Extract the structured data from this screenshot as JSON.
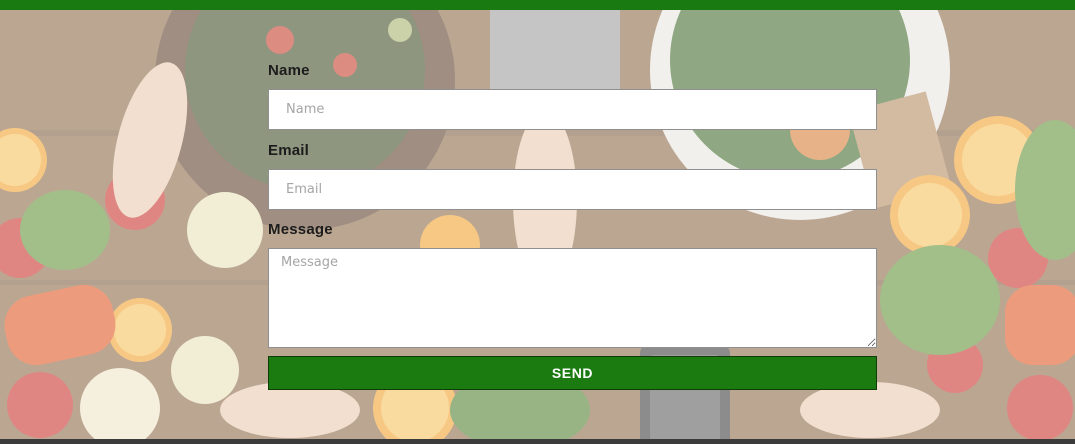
{
  "colors": {
    "accent_bar": "#1a7a12",
    "send_button": "#1b7b10",
    "footer_bar": "#3b3b3b"
  },
  "background": {
    "description_icon": "food-photo-background"
  },
  "form": {
    "name": {
      "label": "Name",
      "placeholder": "Name",
      "value": ""
    },
    "email": {
      "label": "Email",
      "placeholder": "Email",
      "value": ""
    },
    "message": {
      "label": "Message",
      "placeholder": "Message",
      "value": ""
    },
    "submit_label": "SEND"
  }
}
